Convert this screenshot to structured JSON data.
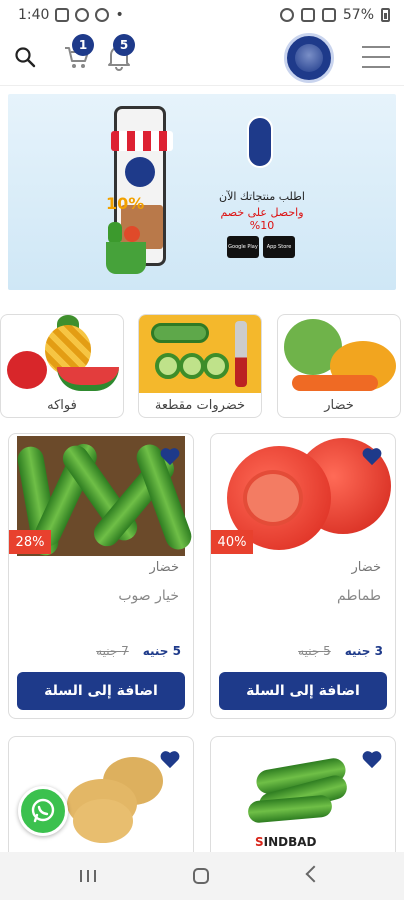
{
  "status_bar": {
    "time": "1:40",
    "battery": "57%"
  },
  "header": {
    "cart_count": "1",
    "notification_count": "5"
  },
  "banner": {
    "line1": "اطلب منتجاتك الآن",
    "line2": "واحصل على خصم 10%",
    "store1": "Google Play",
    "store2": "App Store",
    "phone_badge": "10%"
  },
  "categories": [
    {
      "label": "فواكه"
    },
    {
      "label": "خضروات مقطعة"
    },
    {
      "label": "خضار"
    }
  ],
  "products": [
    {
      "name": "طماطم",
      "category": "خضار",
      "discount": "40%",
      "price": "3 جنيه",
      "old_price": "5 جنيه",
      "button": "اضافة إلى السلة"
    },
    {
      "name": "خيار صوب",
      "category": "خضار",
      "discount": "28%",
      "price": "5 جنيه",
      "old_price": "7 جنيه",
      "button": "اضافة إلى السلة"
    }
  ],
  "bottom_brand": {
    "prefix": "S",
    "rest": "INDBAD"
  },
  "colors": {
    "primary": "#1e3a8a",
    "discount": "#e8412e",
    "whatsapp": "#3bc14e"
  }
}
